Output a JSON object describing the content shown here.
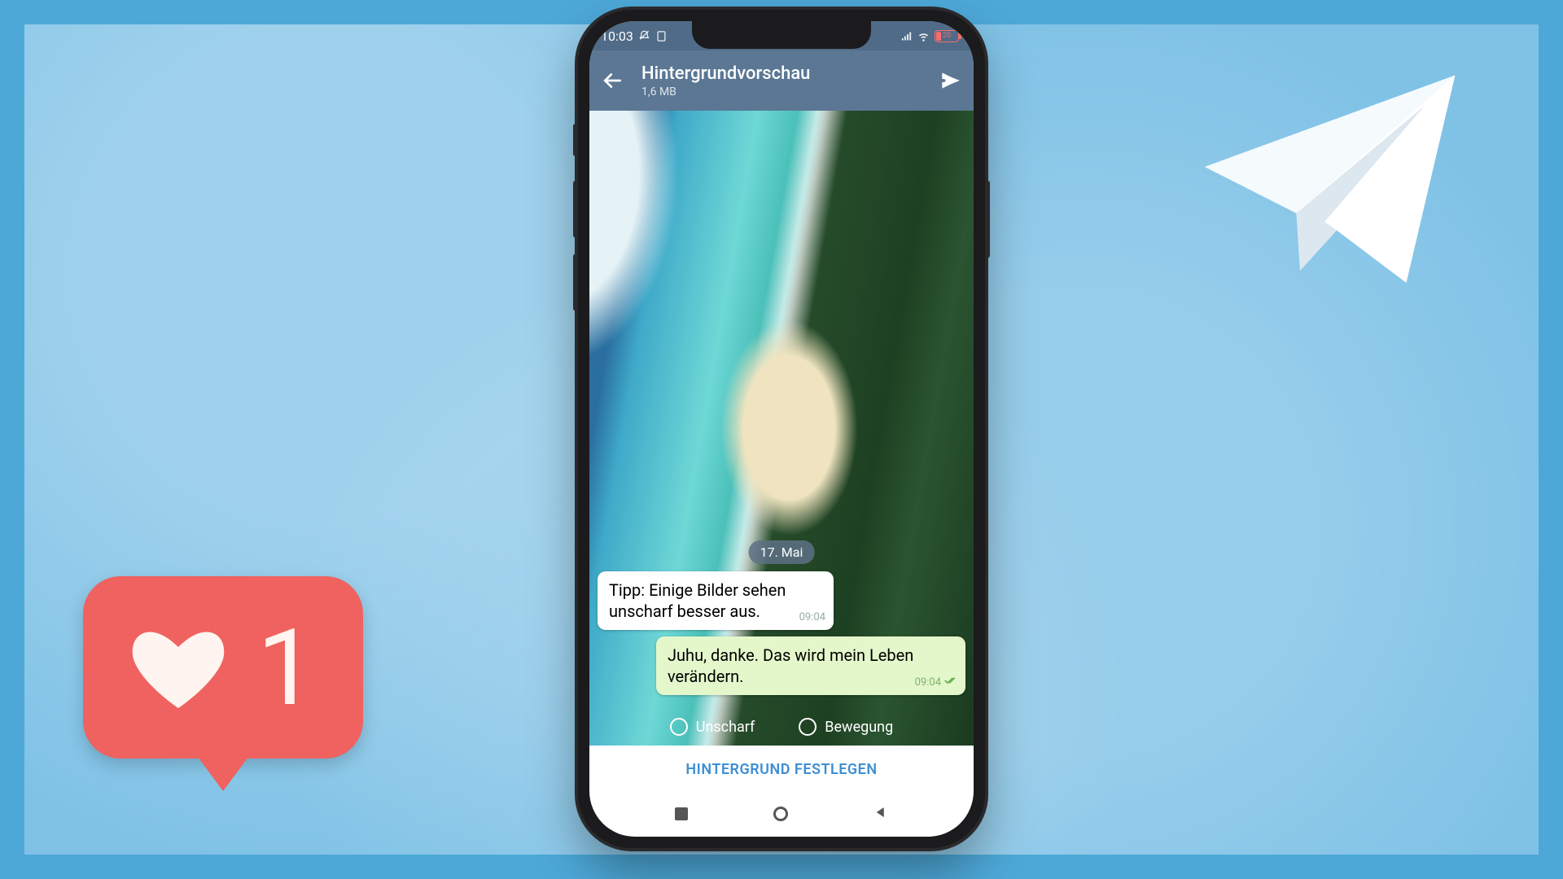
{
  "statusbar": {
    "time": "10:03",
    "battery_pct": "20"
  },
  "header": {
    "title": "Hintergrundvorschau",
    "subtitle": "1,6 MB"
  },
  "chat": {
    "date": "17. Mai",
    "msg_in": {
      "text": "Tipp: Einige Bilder sehen unscharf besser aus.",
      "time": "09:04"
    },
    "msg_out": {
      "text": "Juhu, danke. Das wird mein Leben verändern.",
      "time": "09:04"
    }
  },
  "options": {
    "blur": "Unscharf",
    "motion": "Bewegung"
  },
  "cta": {
    "label": "HINTERGRUND FESTLEGEN"
  },
  "like": {
    "count": "1"
  }
}
